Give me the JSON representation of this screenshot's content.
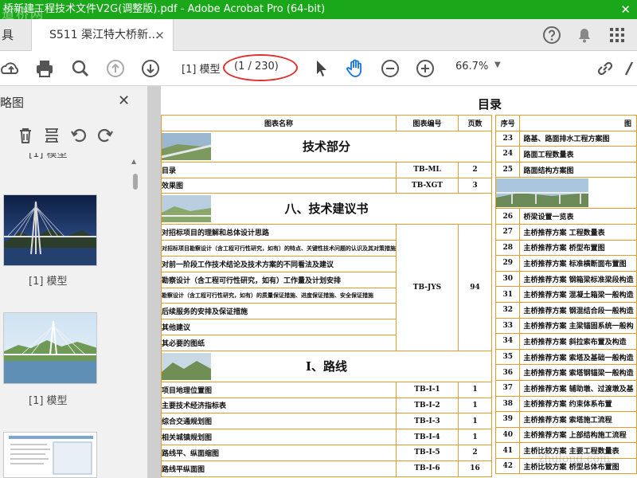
{
  "window": {
    "title": "桥新建工程技术文件V2G(调整版).pdf - Adobe Acrobat Pro (64-bit)",
    "watermark": "道桥网",
    "close": "✕"
  },
  "tabs": {
    "left_fragment": "具",
    "doc_tab": "S511 渠江特大桥新...",
    "close": "×"
  },
  "toolbar": {
    "page_label": "[1] 模型",
    "page_count": "(1 / 230)",
    "zoom": "66.7%"
  },
  "sidebar": {
    "title": "略图",
    "close": "✕",
    "thumbnails": [
      {
        "label": "[1] 模型"
      },
      {
        "label": "[1] 模型"
      },
      {
        "label": "[1] 模型"
      }
    ]
  },
  "document": {
    "title": "目录",
    "left_headers": {
      "name": "图表名称",
      "code": "图表编号",
      "page": "页数"
    },
    "sections": [
      {
        "title": "技术部分"
      },
      {
        "title": "八、技术建议书"
      },
      {
        "title": "I、路线"
      }
    ],
    "rows_a": [
      {
        "name": "目录",
        "code": "TB-ML",
        "page": "2"
      },
      {
        "name": "效果图",
        "code": "TB-XGT",
        "page": "3"
      }
    ],
    "rows_b": [
      {
        "name": "对招标项目的理解和总体设计思路"
      },
      {
        "name": "对招标项目勘察设计（含工程可行性研究，如有）的特点、关键性技术问题的认识及其对策措施"
      },
      {
        "name": "对前一阶段工作技术结论及技术方案的不同看法及建议"
      },
      {
        "name": "勘察设计（含工程可行性研究，如有）工作量及计划安排"
      },
      {
        "name": "勘察设计（含工程可行性研究，如有）的质量保证措施、进度保证措施、安全保证措施"
      },
      {
        "name": "后续服务的安排及保证措施"
      },
      {
        "name": "其他建议"
      },
      {
        "name": "其必要的图纸"
      }
    ],
    "rows_b_code": "TB-JYS",
    "rows_b_page": "94",
    "rows_c": [
      {
        "name": "项目地理位置图",
        "code": "TB-I-1",
        "page": "1"
      },
      {
        "name": "主要技术经济指标表",
        "code": "TB-I-2",
        "page": "1"
      },
      {
        "name": "综合交通规划图",
        "code": "TB-I-3",
        "page": "1"
      },
      {
        "name": "相关城镇规划图",
        "code": "TB-I-4",
        "page": "1"
      },
      {
        "name": "路线平、纵面缩图",
        "code": "TB-I-5",
        "page": "2"
      },
      {
        "name": "路线平纵面图",
        "code": "TB-I-6",
        "page": "16"
      }
    ],
    "right_headers": {
      "no": "序号",
      "name": "图"
    },
    "right_rows_a": [
      {
        "no": "23",
        "name": "路基、路面排水工程方案图"
      },
      {
        "no": "24",
        "name": "路面工程数量表"
      },
      {
        "no": "25",
        "name": "路面结构方案图"
      }
    ],
    "right_rows_b": [
      {
        "no": "26",
        "name": "桥梁设置一览表"
      },
      {
        "no": "27",
        "name": "主桥推荐方案 工程数量表"
      },
      {
        "no": "28",
        "name": "主桥推荐方案 桥型布置图"
      },
      {
        "no": "29",
        "name": "主桥推荐方案 标准横断面布置图"
      },
      {
        "no": "30",
        "name": "主桥推荐方案 钢箱梁标准梁段构造"
      },
      {
        "no": "31",
        "name": "主桥推荐方案 混凝土箱梁一般构造"
      },
      {
        "no": "32",
        "name": "主桥推荐方案 钢混结合段一般构造"
      },
      {
        "no": "33",
        "name": "主桥推荐方案 主梁锚固系统一般构"
      },
      {
        "no": "34",
        "name": "主桥推荐方案 斜拉索布置及构造"
      },
      {
        "no": "35",
        "name": "主桥推荐方案 索塔及基础一般构造"
      },
      {
        "no": "36",
        "name": "主桥推荐方案 索塔钢锚梁一般构造"
      },
      {
        "no": "37",
        "name": "主桥推荐方案 辅助墩、过渡墩及基"
      },
      {
        "no": "38",
        "name": "主桥推荐方案 约束体系布置"
      },
      {
        "no": "39",
        "name": "主桥推荐方案 索塔施工流程"
      },
      {
        "no": "40",
        "name": "主桥推荐方案 上部结构施工流程"
      },
      {
        "no": "41",
        "name": "主桥比较方案 主要工程数量表"
      },
      {
        "no": "42",
        "name": "主桥比较方案 桥型总体布置图"
      }
    ],
    "corner_watermark": "zhulong.com"
  },
  "colors": {
    "titlebar": "#1aa71a",
    "table_border": "#e79b2a",
    "highlight": "#e03030",
    "accent_blue": "#1473e6"
  }
}
